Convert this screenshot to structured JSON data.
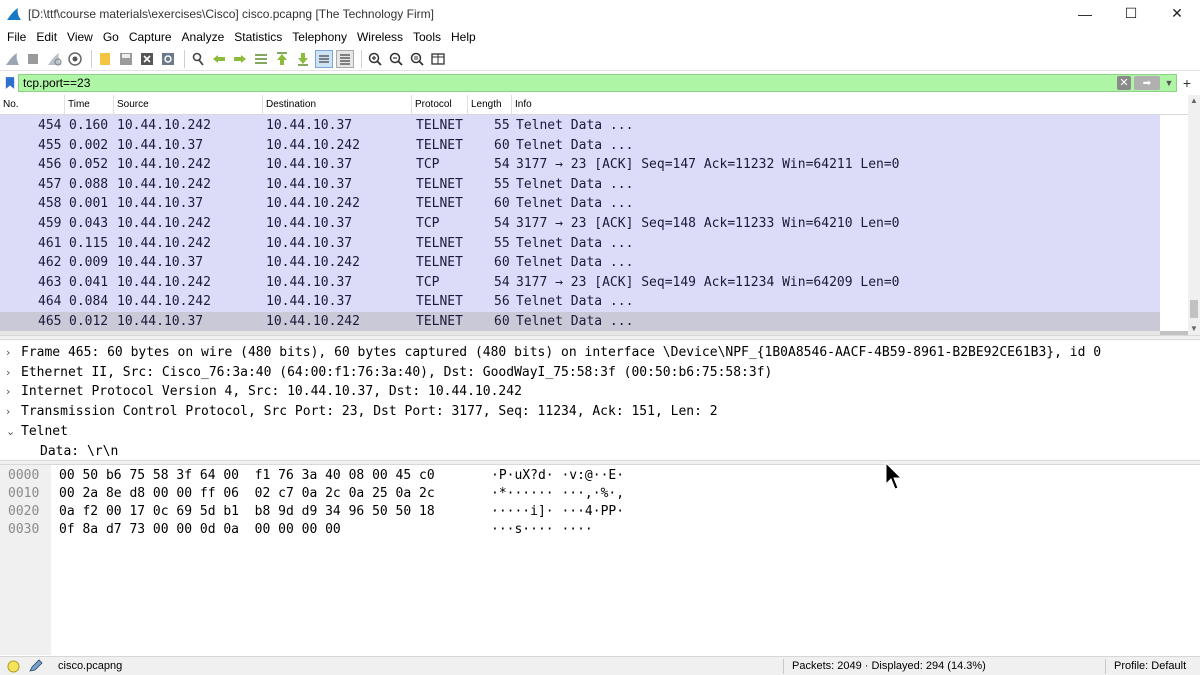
{
  "window": {
    "title": "[D:\\ttf\\course materials\\exercises\\Cisco] cisco.pcapng [The Technology Firm]",
    "minimize_label": "—",
    "maximize_label": "☐",
    "close_label": "✕"
  },
  "menu": [
    "File",
    "Edit",
    "View",
    "Go",
    "Capture",
    "Analyze",
    "Statistics",
    "Telephony",
    "Wireless",
    "Tools",
    "Help"
  ],
  "toolbar_icons": [
    "start-capture-icon",
    "stop-capture-icon",
    "restart-capture-icon",
    "capture-options-icon",
    "open-file-icon",
    "save-file-icon",
    "close-file-icon",
    "reload-file-icon",
    "find-packet-icon",
    "go-back-icon",
    "go-forward-icon",
    "go-to-packet-icon",
    "go-first-icon",
    "go-last-icon",
    "auto-scroll-icon",
    "colorize-icon",
    "zoom-in-icon",
    "zoom-out-icon",
    "zoom-normal-icon",
    "resize-columns-icon"
  ],
  "filter": {
    "value": "tcp.port==23",
    "bg_color": "#aff5a6",
    "add_label": "+"
  },
  "packet_list": {
    "columns": [
      "No.",
      "Time",
      "Source",
      "Destination",
      "Protocol",
      "Length",
      "Info"
    ],
    "row_color": "#dcdcf8",
    "selected_color": "#c9c9d8",
    "rows": [
      {
        "no": "454",
        "time": "0.160",
        "src": "10.44.10.242",
        "dst": "10.44.10.37",
        "proto": "TELNET",
        "len": "55",
        "info": "Telnet Data ..."
      },
      {
        "no": "455",
        "time": "0.002",
        "src": "10.44.10.37",
        "dst": "10.44.10.242",
        "proto": "TELNET",
        "len": "60",
        "info": "Telnet Data ..."
      },
      {
        "no": "456",
        "time": "0.052",
        "src": "10.44.10.242",
        "dst": "10.44.10.37",
        "proto": "TCP",
        "len": "54",
        "info": "3177 → 23 [ACK] Seq=147 Ack=11232 Win=64211 Len=0"
      },
      {
        "no": "457",
        "time": "0.088",
        "src": "10.44.10.242",
        "dst": "10.44.10.37",
        "proto": "TELNET",
        "len": "55",
        "info": "Telnet Data ..."
      },
      {
        "no": "458",
        "time": "0.001",
        "src": "10.44.10.37",
        "dst": "10.44.10.242",
        "proto": "TELNET",
        "len": "60",
        "info": "Telnet Data ..."
      },
      {
        "no": "459",
        "time": "0.043",
        "src": "10.44.10.242",
        "dst": "10.44.10.37",
        "proto": "TCP",
        "len": "54",
        "info": "3177 → 23 [ACK] Seq=148 Ack=11233 Win=64210 Len=0"
      },
      {
        "no": "461",
        "time": "0.115",
        "src": "10.44.10.242",
        "dst": "10.44.10.37",
        "proto": "TELNET",
        "len": "55",
        "info": "Telnet Data ..."
      },
      {
        "no": "462",
        "time": "0.009",
        "src": "10.44.10.37",
        "dst": "10.44.10.242",
        "proto": "TELNET",
        "len": "60",
        "info": "Telnet Data ..."
      },
      {
        "no": "463",
        "time": "0.041",
        "src": "10.44.10.242",
        "dst": "10.44.10.37",
        "proto": "TCP",
        "len": "54",
        "info": "3177 → 23 [ACK] Seq=149 Ack=11234 Win=64209 Len=0"
      },
      {
        "no": "464",
        "time": "0.084",
        "src": "10.44.10.242",
        "dst": "10.44.10.37",
        "proto": "TELNET",
        "len": "56",
        "info": "Telnet Data ..."
      },
      {
        "no": "465",
        "time": "0.012",
        "src": "10.44.10.37",
        "dst": "10.44.10.242",
        "proto": "TELNET",
        "len": "60",
        "info": "Telnet Data ...",
        "selected": true
      }
    ]
  },
  "details": [
    {
      "expander": "›",
      "text": "Frame 465: 60 bytes on wire (480 bits), 60 bytes captured (480 bits) on interface \\Device\\NPF_{1B0A8546-AACF-4B59-8961-B2BE92CE61B3}, id 0"
    },
    {
      "expander": "›",
      "text": "Ethernet II, Src: Cisco_76:3a:40 (64:00:f1:76:3a:40), Dst: GoodWayI_75:58:3f (00:50:b6:75:58:3f)"
    },
    {
      "expander": "›",
      "text": "Internet Protocol Version 4, Src: 10.44.10.37, Dst: 10.44.10.242"
    },
    {
      "expander": "›",
      "text": "Transmission Control Protocol, Src Port: 23, Dst Port: 3177, Seq: 11234, Ack: 151, Len: 2"
    },
    {
      "expander": "⌄",
      "text": "Telnet"
    },
    {
      "expander": "",
      "text": "Data: \\r\\n",
      "child": true
    }
  ],
  "bytes": [
    {
      "offset": "0000",
      "hex": "00 50 b6 75 58 3f 64 00  f1 76 3a 40 08 00 45 c0",
      "ascii": "·P·uX?d· ·v:@··E·"
    },
    {
      "offset": "0010",
      "hex": "00 2a 8e d8 00 00 ff 06  02 c7 0a 2c 0a 25 0a 2c",
      "ascii": "·*······ ···,·%·,"
    },
    {
      "offset": "0020",
      "hex": "0a f2 00 17 0c 69 5d b1  b8 9d d9 34 96 50 50 18",
      "ascii": "·····i]· ···4·PP·"
    },
    {
      "offset": "0030",
      "hex": "0f 8a d7 73 00 00 0d 0a  00 00 00 00",
      "ascii": "···s···· ····"
    }
  ],
  "status": {
    "file": "cisco.pcapng",
    "packets": "Packets: 2049 · Displayed: 294 (14.3%)",
    "profile": "Profile: Default"
  }
}
